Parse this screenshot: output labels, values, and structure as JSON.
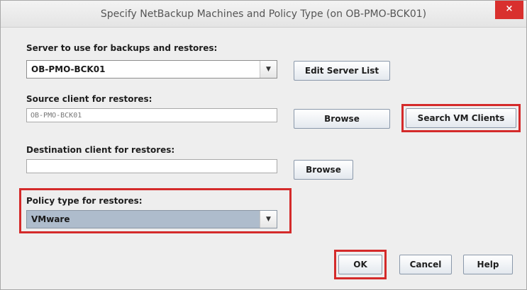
{
  "window": {
    "title": "Specify NetBackup Machines and Policy Type (on OB-PMO-BCK01)",
    "close_label": "×"
  },
  "server": {
    "label": "Server to use for backups and restores:",
    "value": "OB-PMO-BCK01",
    "edit_button": "Edit Server List"
  },
  "source": {
    "label": "Source client for restores:",
    "value": "OB-PMO-BCK01",
    "browse_button": "Browse",
    "search_button": "Search VM Clients"
  },
  "destination": {
    "label": "Destination client for restores:",
    "value": "",
    "browse_button": "Browse"
  },
  "policy": {
    "label": "Policy type for restores:",
    "value": "VMware"
  },
  "buttons": {
    "ok": "OK",
    "cancel": "Cancel",
    "help": "Help"
  },
  "icons": {
    "dropdown": "▼"
  },
  "colors": {
    "highlight": "#d42a2a",
    "close": "#d9302e",
    "selected_combo": "#aebccc"
  }
}
